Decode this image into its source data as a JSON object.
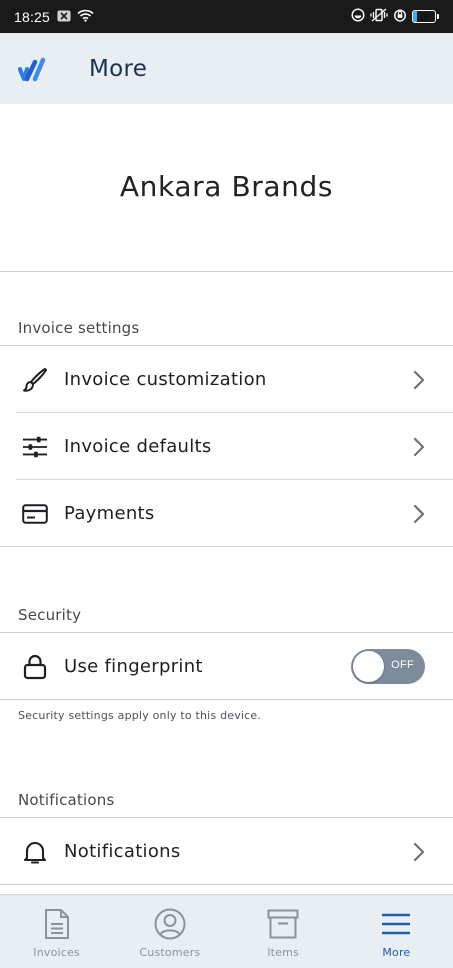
{
  "status_bar": {
    "time": "18:25",
    "battery_level": "16",
    "battery_fraction": 0.16,
    "icons": [
      "notification-icon",
      "wifi-icon",
      "sync-icon",
      "vibrate-icon",
      "alarm-icon",
      "battery-icon"
    ]
  },
  "app_bar": {
    "title": "More",
    "logo": "wave-logo"
  },
  "business": {
    "name": "Ankara Brands"
  },
  "invoice_settings": {
    "label": "Invoice settings",
    "items": [
      {
        "label": "Invoice customization",
        "icon": "brush-icon"
      },
      {
        "label": "Invoice defaults",
        "icon": "sliders-icon"
      },
      {
        "label": "Payments",
        "icon": "credit-card-icon"
      }
    ]
  },
  "security": {
    "label": "Security",
    "fingerprint_label": "Use fingerprint",
    "toggle_text": "OFF",
    "toggle_on": false,
    "helper": "Security settings apply only to this device."
  },
  "notifications": {
    "label": "Notifications",
    "item_label": "Notifications"
  },
  "bottom_nav": {
    "items": [
      {
        "label": "Invoices",
        "icon": "document-icon",
        "active": false
      },
      {
        "label": "Customers",
        "icon": "person-circle-icon",
        "active": false
      },
      {
        "label": "Items",
        "icon": "archive-box-icon",
        "active": false
      },
      {
        "label": "More",
        "icon": "menu-icon",
        "active": true
      }
    ]
  },
  "colors": {
    "app_bar_bg": "#e9eef2",
    "title_text": "#1c3250",
    "active_nav": "#1d5ea8",
    "inactive_nav": "#8a939c",
    "toggle_off": "#7c8c9a"
  }
}
